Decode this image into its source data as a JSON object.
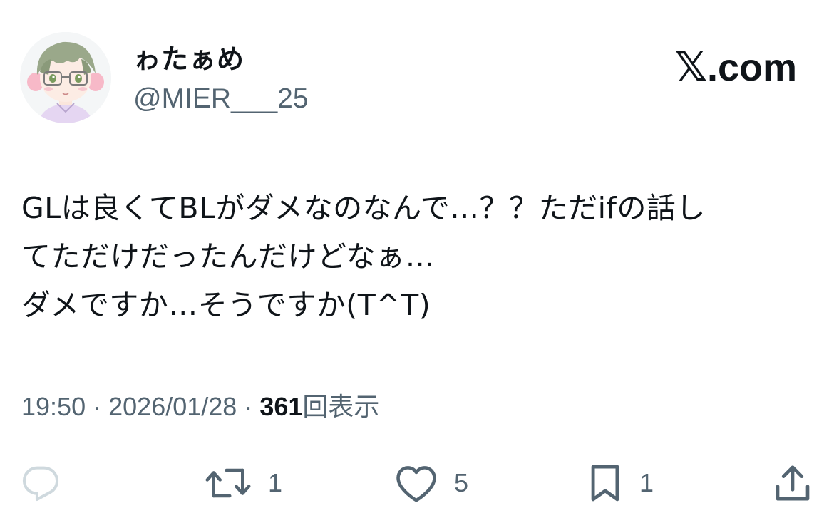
{
  "author": {
    "display_name": "ゎたぁめ",
    "handle": "@MIER___25",
    "avatar_icon": "avatar-illustration"
  },
  "site": {
    "x_glyph": "𝕏",
    "label": ".com"
  },
  "tweet": {
    "lines": [
      "GLは良くてBLがダメなのなんで…？？ただifの話し",
      "てただけだったんだけどなぁ…",
      "ダメですか…そうですか(T^T)"
    ]
  },
  "meta": {
    "time": "19:50",
    "separator": "·",
    "date": "2026/01/28",
    "views_count": "361",
    "views_label": "回表示"
  },
  "actions": {
    "reply": {
      "icon": "reply-icon"
    },
    "retweet": {
      "icon": "retweet-icon",
      "count": "1"
    },
    "like": {
      "icon": "heart-icon",
      "count": "5"
    },
    "bookmark": {
      "icon": "bookmark-icon",
      "count": "1"
    },
    "share": {
      "icon": "share-icon"
    }
  },
  "colors": {
    "text_primary": "#0f1419",
    "text_secondary": "#536471",
    "reply_icon": "#cfd9de",
    "avatar_hair": "#9aa88a",
    "avatar_cheek": "#f7b9c8"
  }
}
